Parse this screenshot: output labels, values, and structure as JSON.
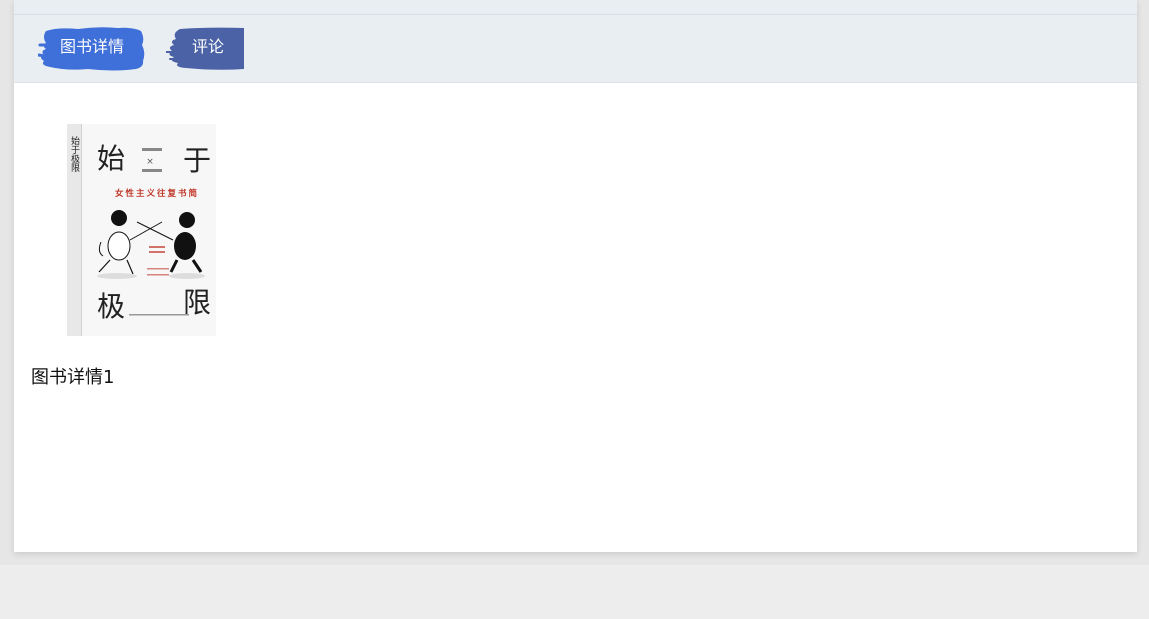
{
  "tabs": [
    {
      "label": "图书详情",
      "active": true,
      "color": "#3f6fd8"
    },
    {
      "label": "评论",
      "active": false,
      "color": "#4b63a6"
    }
  ],
  "book": {
    "cover": {
      "title_top_left": "始",
      "title_top_right": "于",
      "title_bottom_left": "极",
      "title_bottom_right": "限",
      "spine_text": "始于极限",
      "subtitle": "女性主义往复书简"
    },
    "detail_text": "图书详情1"
  },
  "colors": {
    "page_bg": "#ededed",
    "tabbar_bg": "#e9eef3",
    "card_bg": "#ffffff",
    "accent_red": "#c0392b"
  }
}
